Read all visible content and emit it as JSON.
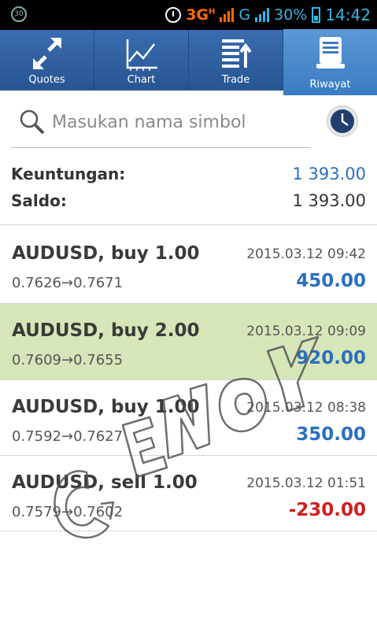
{
  "status_bar": {
    "notification_badge": "30",
    "network": "3G",
    "network_sup": "H",
    "network2": "G",
    "battery": "30%",
    "time": "14:42"
  },
  "tabs": [
    {
      "label": "Quotes",
      "icon": "quotes-arrows-icon",
      "active": false
    },
    {
      "label": "Chart",
      "icon": "chart-line-icon",
      "active": false
    },
    {
      "label": "Trade",
      "icon": "trade-list-icon",
      "active": false
    },
    {
      "label": "Riwayat",
      "icon": "history-terminal-icon",
      "active": true
    }
  ],
  "search": {
    "placeholder": "Masukan nama simbol"
  },
  "summary": {
    "profit_label": "Keuntungan:",
    "profit_value": "1 393.00",
    "balance_label": "Saldo:",
    "balance_value": "1 393.00"
  },
  "trades": [
    {
      "title": "AUDUSD, buy 1.00",
      "time": "2015.03.12 09:42",
      "prices": "0.7626→0.7671",
      "profit": "450.00",
      "highlight": false
    },
    {
      "title": "AUDUSD, buy 2.00",
      "time": "2015.03.12 09:09",
      "prices": "0.7609→0.7655",
      "profit": "920.00",
      "highlight": true
    },
    {
      "title": "AUDUSD, buy 1.00",
      "time": "2015.03.12 08:38",
      "prices": "0.7592→0.7627",
      "profit": "350.00",
      "highlight": false
    },
    {
      "title": "AUDUSD, sell 1.00",
      "time": "2015.03.12 01:51",
      "prices": "0.7579→0.7602",
      "profit": "-230.00",
      "highlight": false
    }
  ],
  "colors": {
    "tab_bar": "#2c5e9f",
    "tab_active": "#4a88cc",
    "profit_blue": "#2a6fc0",
    "loss_red": "#d21e1e",
    "highlight_row": "#d7e6b8"
  },
  "watermark": "GENOY"
}
